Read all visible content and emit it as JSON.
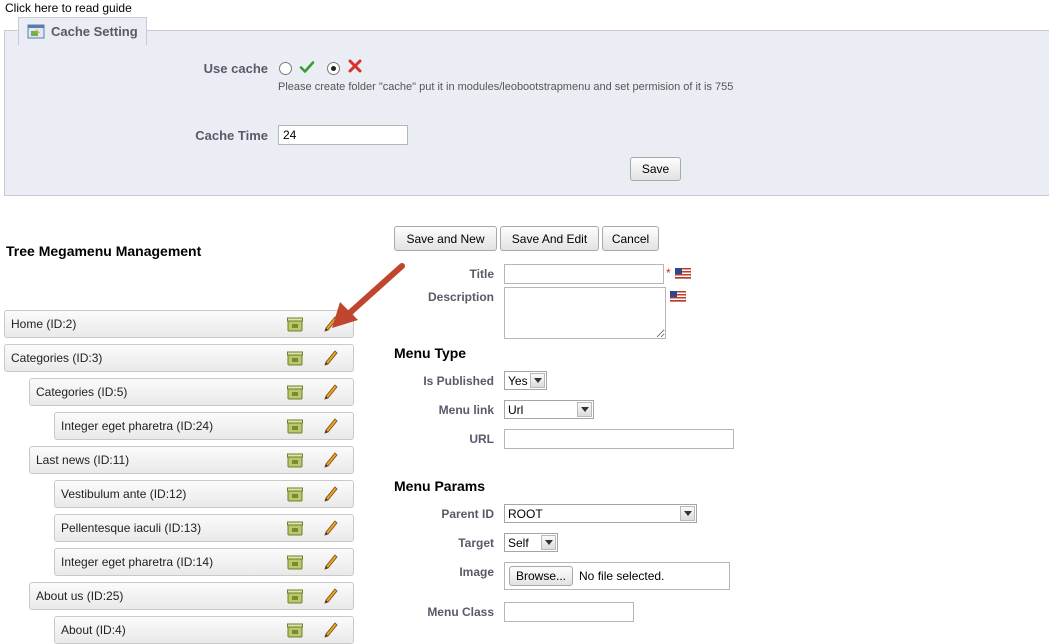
{
  "guide_link": "Click here to read guide",
  "cache": {
    "legend": "Cache Setting",
    "use_cache_label": "Use cache",
    "use_cache_value": "no",
    "note": "Please create folder \"cache\" put it in modules/leobootstrapmenu and set permision of it is 755",
    "cache_time_label": "Cache Time",
    "cache_time_value": "24",
    "save_label": "Save"
  },
  "tree": {
    "title": "Tree Megamenu Management",
    "items": [
      {
        "label": "Home (ID:2)",
        "level": 0
      },
      {
        "label": "Categories (ID:3)",
        "level": 0
      },
      {
        "label": "Categories (ID:5)",
        "level": 1
      },
      {
        "label": "Integer eget pharetra (ID:24)",
        "level": 2
      },
      {
        "label": "Last news (ID:11)",
        "level": 1
      },
      {
        "label": "Vestibulum ante (ID:12)",
        "level": 2
      },
      {
        "label": "Pellentesque iaculi (ID:13)",
        "level": 2
      },
      {
        "label": "Integer eget pharetra (ID:14)",
        "level": 2
      },
      {
        "label": "About us (ID:25)",
        "level": 1
      },
      {
        "label": "About (ID:4)",
        "level": 2
      }
    ]
  },
  "toolbar": {
    "save_new": "Save and New",
    "save_edit": "Save And Edit",
    "cancel": "Cancel"
  },
  "form": {
    "title_label": "Title",
    "title_value": "",
    "required_mark": "*",
    "description_label": "Description",
    "description_value": "",
    "menu_type_head": "Menu Type",
    "published_label": "Is Published",
    "published_value": "Yes",
    "menu_link_label": "Menu link",
    "menu_link_value": "Url",
    "url_label": "URL",
    "url_value": "",
    "menu_params_head": "Menu Params",
    "parent_label": "Parent ID",
    "parent_value": "ROOT",
    "target_label": "Target",
    "target_value": "Self",
    "image_label": "Image",
    "browse_label": "Browse...",
    "no_file": "No file selected.",
    "menu_class_label": "Menu Class",
    "menu_class_value": ""
  },
  "colors": {
    "panel_bg": "#ebedf4",
    "label": "#585a69",
    "arrow": "#c0452d",
    "check": "#3a9b2f",
    "cross": "#d8322a"
  }
}
